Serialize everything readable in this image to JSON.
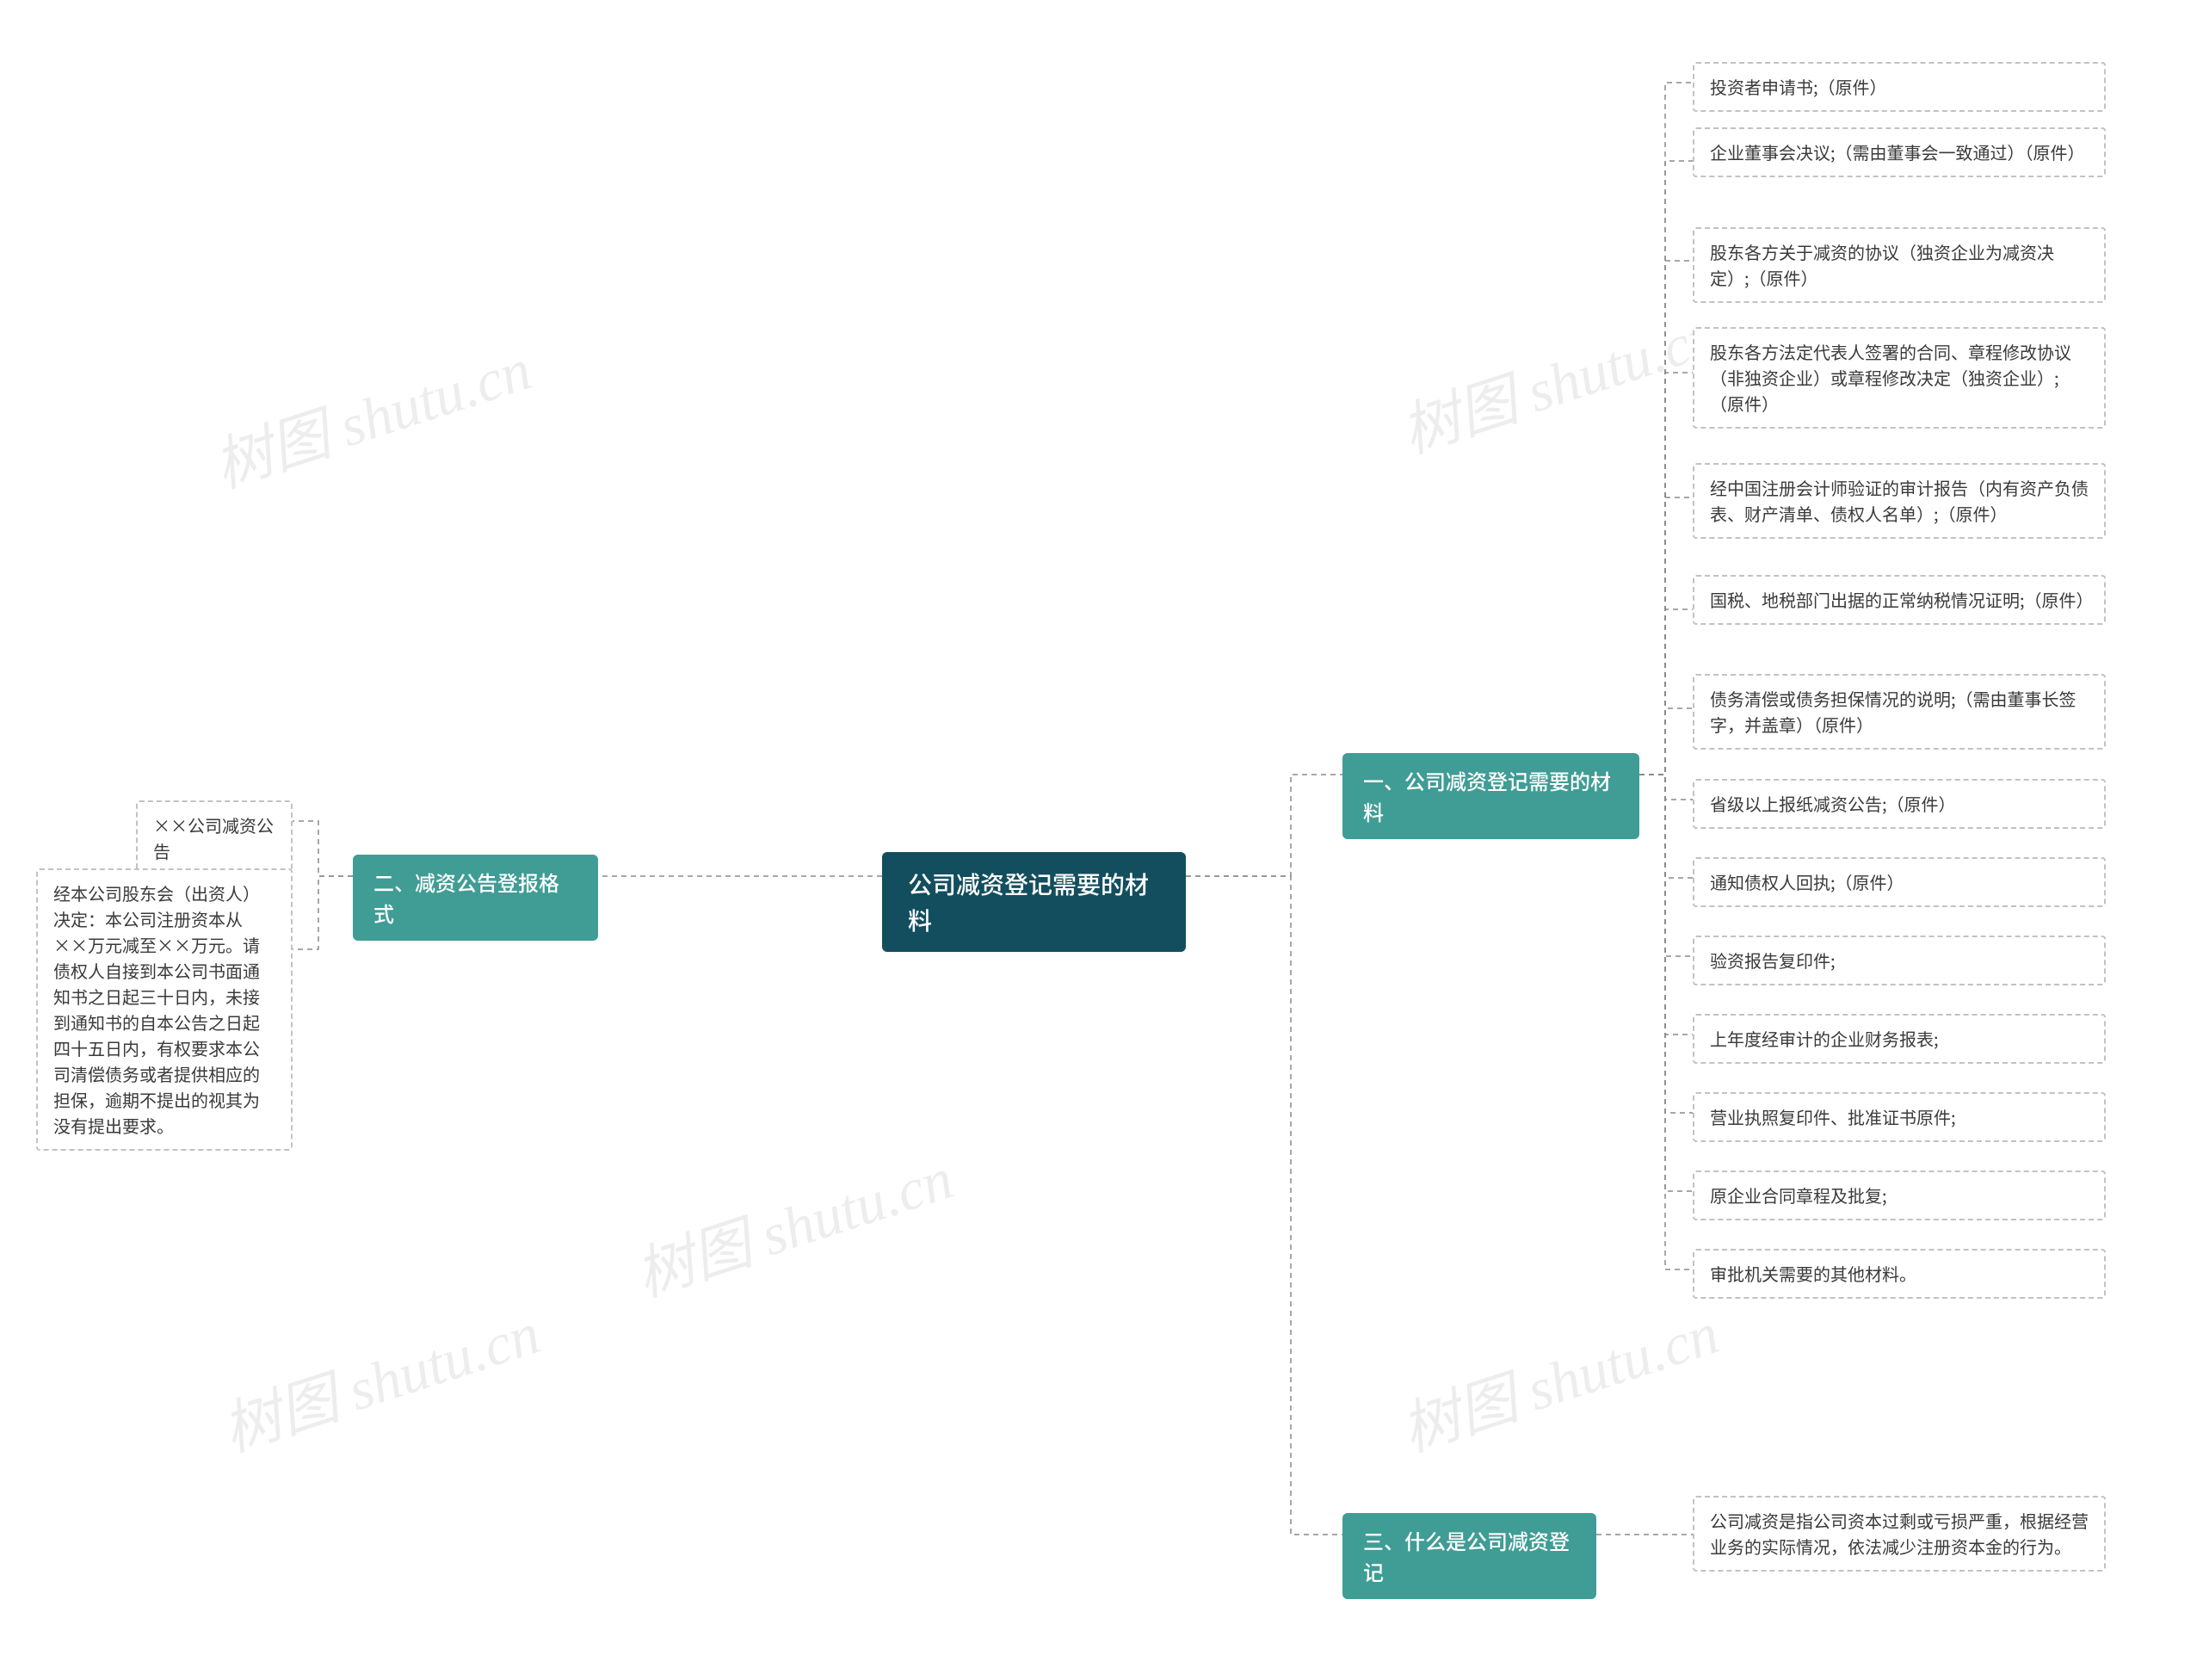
{
  "watermark": "树图 shutu.cn",
  "root": {
    "title": "公司减资登记需要的材料"
  },
  "branches": {
    "b1": {
      "title": "一、公司减资登记需要的材料",
      "leaves": [
        "投资者申请书;（原件）",
        "企业董事会决议;（需由董事会一致通过）（原件）",
        "股东各方关于减资的协议（独资企业为减资决定）;（原件）",
        "股东各方法定代表人签署的合同、章程修改协议（非独资企业）或章程修改决定（独资企业）;（原件）",
        "经中国注册会计师验证的审计报告（内有资产负债表、财产清单、债权人名单）;（原件）",
        "国税、地税部门出据的正常纳税情况证明;（原件）",
        "债务清偿或债务担保情况的说明;（需由董事长签字，并盖章）（原件）",
        "省级以上报纸减资公告;（原件）",
        "通知债权人回执;（原件）",
        "验资报告复印件;",
        "上年度经审计的企业财务报表;",
        "营业执照复印件、批准证书原件;",
        "原企业合同章程及批复;",
        "审批机关需要的其他材料。"
      ]
    },
    "b2": {
      "title": "二、减资公告登报格式",
      "leaves": [
        "××公司减资公告",
        "经本公司股东会（出资人）决定：本公司注册资本从××万元减至××万元。请债权人自接到本公司书面通知书之日起三十日内，未接到通知书的自本公告之日起四十五日内，有权要求本公司清偿债务或者提供相应的担保，逾期不提出的视其为没有提出要求。"
      ]
    },
    "b3": {
      "title": "三、什么是公司减资登记",
      "leaves": [
        "公司减资是指公司资本过剩或亏损严重，根据经营业务的实际情况，依法减少注册资本金的行为。"
      ]
    }
  }
}
